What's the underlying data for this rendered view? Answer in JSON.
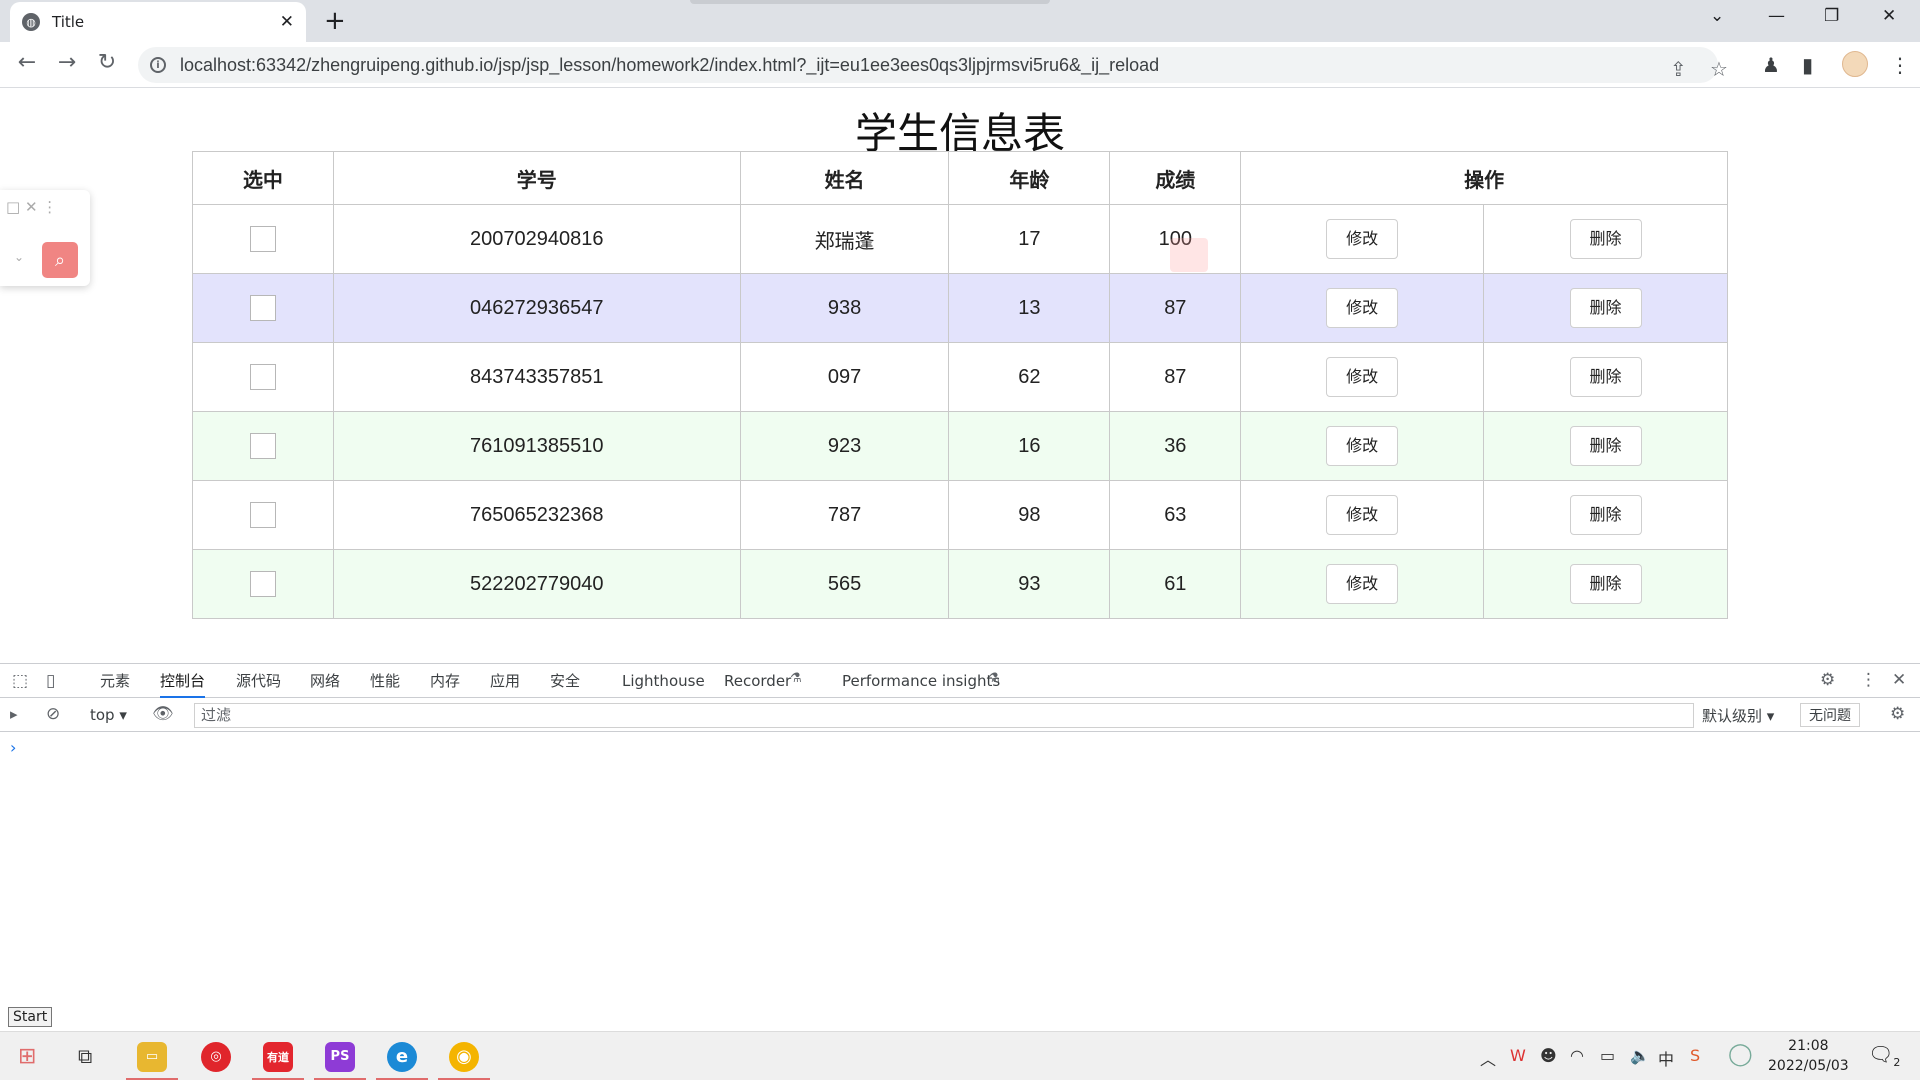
{
  "browser": {
    "tab_title": "Title",
    "url": "localhost:63342/zhengruipeng.github.io/jsp/jsp_lesson/homework2/index.html?_ijt=eu1ee3ees0qs3ljpjrmsvi5ru6&_ij_reload"
  },
  "page": {
    "title": "学生信息表",
    "headers": {
      "select": "选中",
      "id": "学号",
      "name": "姓名",
      "age": "年龄",
      "score": "成绩",
      "actions": "操作"
    },
    "edit_label": "修改",
    "delete_label": "删除",
    "rows": [
      {
        "id": "200702940816",
        "name": "郑瑞蓬",
        "age": "17",
        "score": "100",
        "bg": "white"
      },
      {
        "id": "046272936547",
        "name": "938",
        "age": "13",
        "score": "87",
        "bg": "hover"
      },
      {
        "id": "843743357851",
        "name": "097",
        "age": "62",
        "score": "87",
        "bg": "white"
      },
      {
        "id": "761091385510",
        "name": "923",
        "age": "16",
        "score": "36",
        "bg": "green"
      },
      {
        "id": "765065232368",
        "name": "787",
        "age": "98",
        "score": "63",
        "bg": "white"
      },
      {
        "id": "522202779040",
        "name": "565",
        "age": "93",
        "score": "61",
        "bg": "green"
      }
    ]
  },
  "devtools": {
    "tabs": [
      "元素",
      "控制台",
      "源代码",
      "网络",
      "性能",
      "内存",
      "应用",
      "安全",
      "Lighthouse",
      "Recorder",
      "Performance insights"
    ],
    "active_tab": "控制台",
    "context": "top",
    "filter_placeholder": "过滤",
    "level": "默认级别",
    "issues": "无问题",
    "prompt": "›"
  },
  "taskbar": {
    "start_tooltip": "Start",
    "time": "21:08",
    "date": "2022/05/03",
    "ime": "中",
    "notif_count": "2",
    "apps": [
      {
        "name": "file-explorer",
        "glyph": "",
        "color": "#e8b730"
      },
      {
        "name": "netease-music",
        "glyph": "◎",
        "color": "#e0252b"
      },
      {
        "name": "youdao",
        "glyph": "有道",
        "color": "#e3262e"
      },
      {
        "name": "phpstorm",
        "glyph": "PS",
        "color": "#8e3bd6"
      },
      {
        "name": "edge",
        "glyph": "e",
        "color": "#1c8ad6"
      },
      {
        "name": "chrome",
        "glyph": "◉",
        "color": "#f4b400"
      }
    ]
  },
  "colors": {
    "hover_row": "#e3e3fc",
    "green_row": "#f0fdf1",
    "accent": "#1a73e8"
  }
}
